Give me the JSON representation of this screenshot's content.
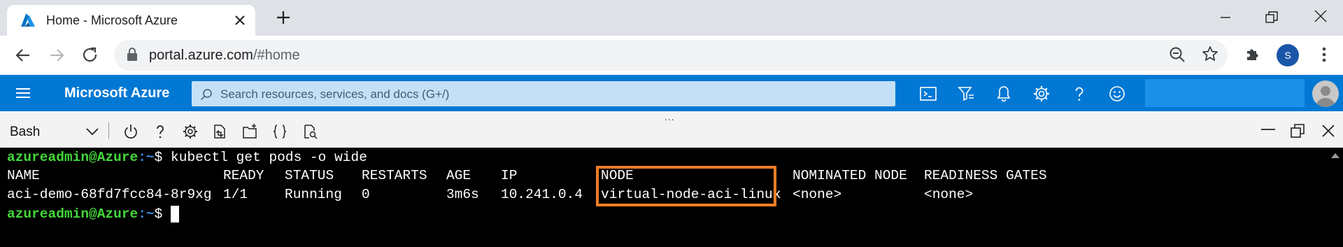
{
  "browser": {
    "tab_title": "Home - Microsoft Azure",
    "url_host": "portal.azure.com",
    "url_path": "/#home",
    "profile_initial": "S"
  },
  "azure": {
    "brand": "Microsoft Azure",
    "search_placeholder": "Search resources, services, and docs (G+/)",
    "header_color": "#0078d4"
  },
  "shell": {
    "grip": "...",
    "shell_type": "Bash"
  },
  "terminal": {
    "prompt_user": "azureadmin@Azure",
    "prompt_path": ":~",
    "prompt_symbol": "$",
    "command": " kubectl get pods -o wide",
    "columns": [
      "NAME",
      "READY",
      "STATUS",
      "RESTARTS",
      "AGE",
      "IP",
      "NODE",
      "NOMINATED NODE",
      "READINESS GATES"
    ],
    "row": [
      "aci-demo-68fd7fcc84-8r9xg",
      "1/1",
      "Running",
      "0",
      "3m6s",
      "10.241.0.4",
      "virtual-node-aci-linux",
      "<none>",
      "<none>"
    ],
    "highlight_color": "#f07d25"
  }
}
